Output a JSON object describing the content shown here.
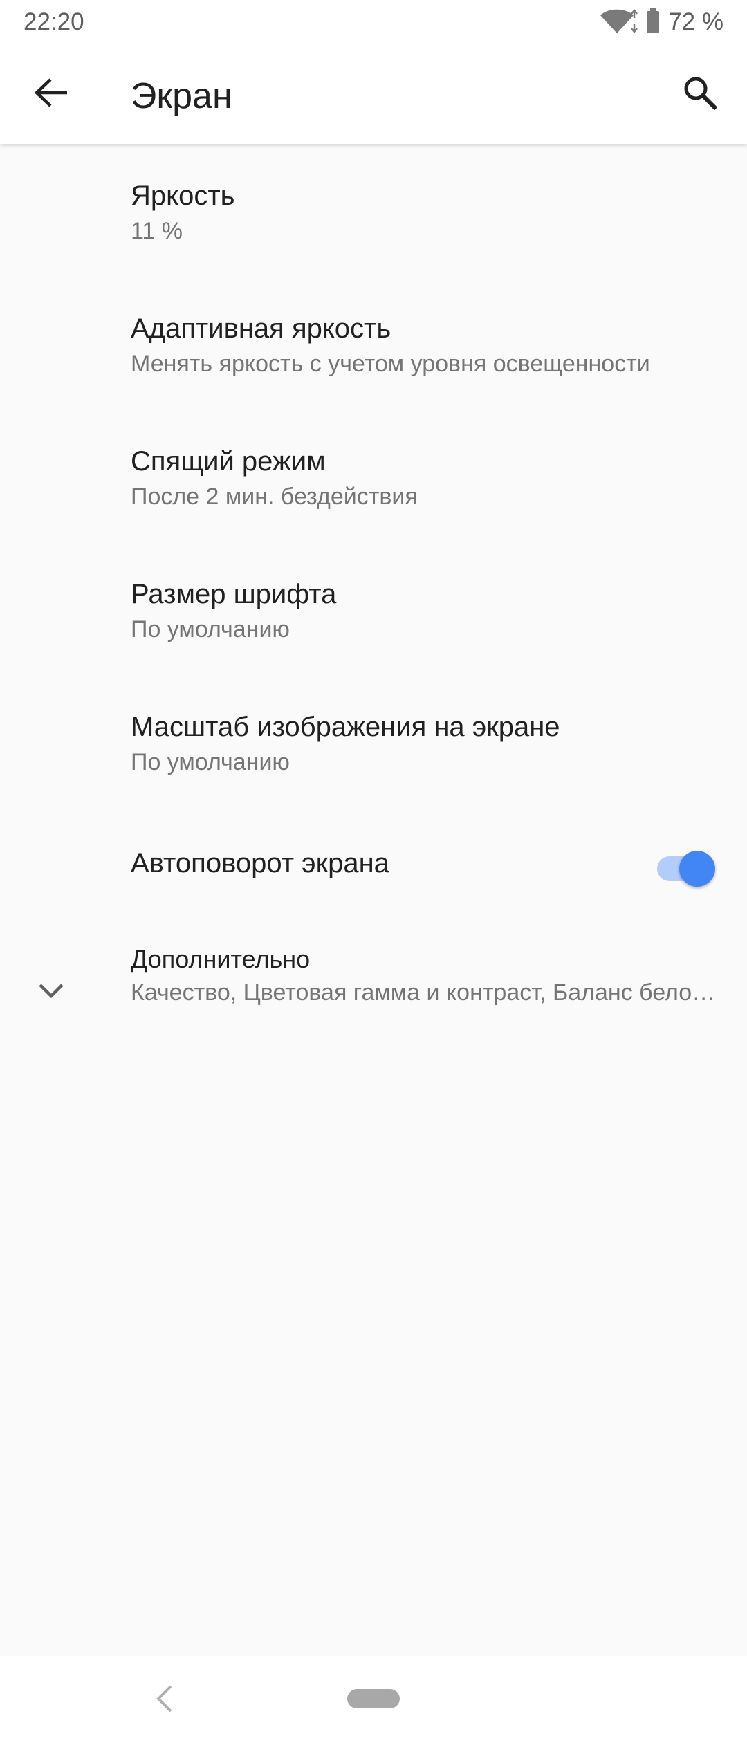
{
  "status_bar": {
    "time": "22:20",
    "battery_percent": "72 %",
    "icons": [
      "wifi-icon",
      "battery-icon"
    ]
  },
  "toolbar": {
    "title": "Экран",
    "icons": [
      "arrow-back-icon",
      "search-icon"
    ]
  },
  "settings": {
    "brightness": {
      "title": "Яркость",
      "summary": "11 %"
    },
    "adaptive_brightness": {
      "title": "Адаптивная яркость",
      "summary": "Менять яркость с учетом уровня освещенности"
    },
    "sleep": {
      "title": "Спящий режим",
      "summary": "После 2 мин. бездействия"
    },
    "font_size": {
      "title": "Размер шрифта",
      "summary": "По умолчанию"
    },
    "display_size": {
      "title": "Масштаб изображения на экране",
      "summary": "По умолчанию"
    },
    "auto_rotate": {
      "title": "Автоповорот экрана",
      "enabled": true
    },
    "advanced": {
      "title": "Дополнительно",
      "summary": "Качество, Цветовая гамма и контраст, Баланс белого, Яркость при просмотре видео",
      "icon": "chevron-down-icon"
    }
  },
  "colors": {
    "accent": "#4285f4",
    "accent_track": "#b3cdfb",
    "background": "#fafafa"
  },
  "nav_bar": {
    "icons": [
      "nav-back-icon",
      "home-pill"
    ]
  }
}
